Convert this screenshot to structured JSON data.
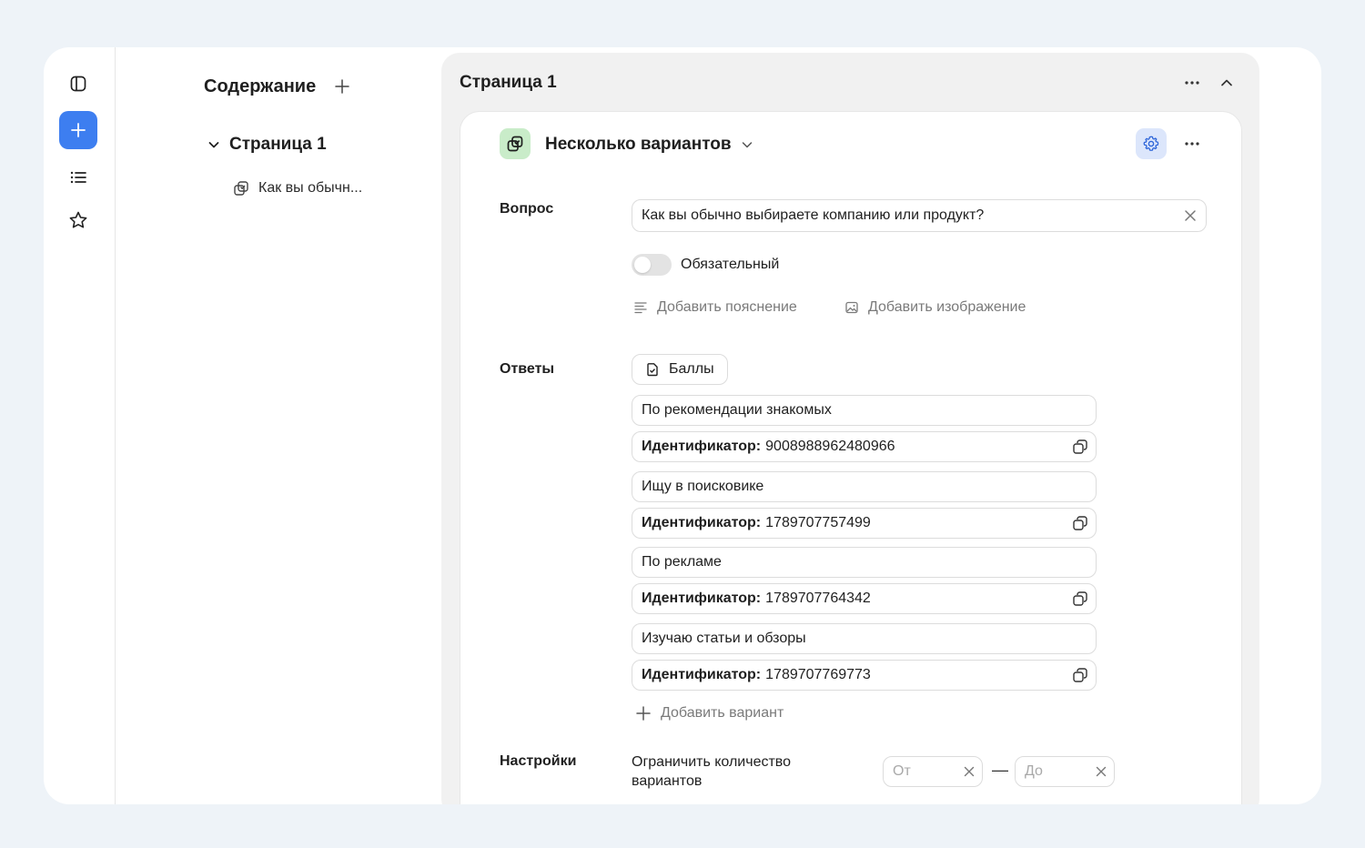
{
  "sidebar": {
    "icons": [
      "panel-toggle-icon",
      "plus-icon",
      "list-icon",
      "star-icon"
    ]
  },
  "outline": {
    "title": "Содержание",
    "page_label": "Страница 1",
    "question_label": "Как вы обычн..."
  },
  "page": {
    "title": "Страница 1"
  },
  "question_card": {
    "type_label": "Несколько вариантов",
    "question_label": "Вопрос",
    "question_value": "Как вы обычно выбираете компанию или продукт?",
    "required_label": "Обязательный",
    "required_on": false,
    "add_hint_label": "Добавить пояснение",
    "add_image_label": "Добавить изображение",
    "answers_label": "Ответы",
    "scores_label": "Баллы",
    "id_prefix": "Идентификатор:",
    "answers": [
      {
        "text": "По рекомендации знакомых",
        "id": "9008988962480966"
      },
      {
        "text": "Ищу в поисковике",
        "id": "1789707757499"
      },
      {
        "text": "По рекламе",
        "id": "1789707764342"
      },
      {
        "text": "Изучаю статьи и обзоры",
        "id": "1789707769773"
      }
    ],
    "add_variant_label": "Добавить вариант",
    "settings_label": "Настройки",
    "limit_label": "Ограничить количество вариантов",
    "from_placeholder": "От",
    "to_placeholder": "До",
    "range_dash": "—"
  },
  "colors": {
    "accent": "#3d7ef0",
    "type_icon_bg": "#c9ecc9",
    "settings_bg": "#dce6fb"
  }
}
